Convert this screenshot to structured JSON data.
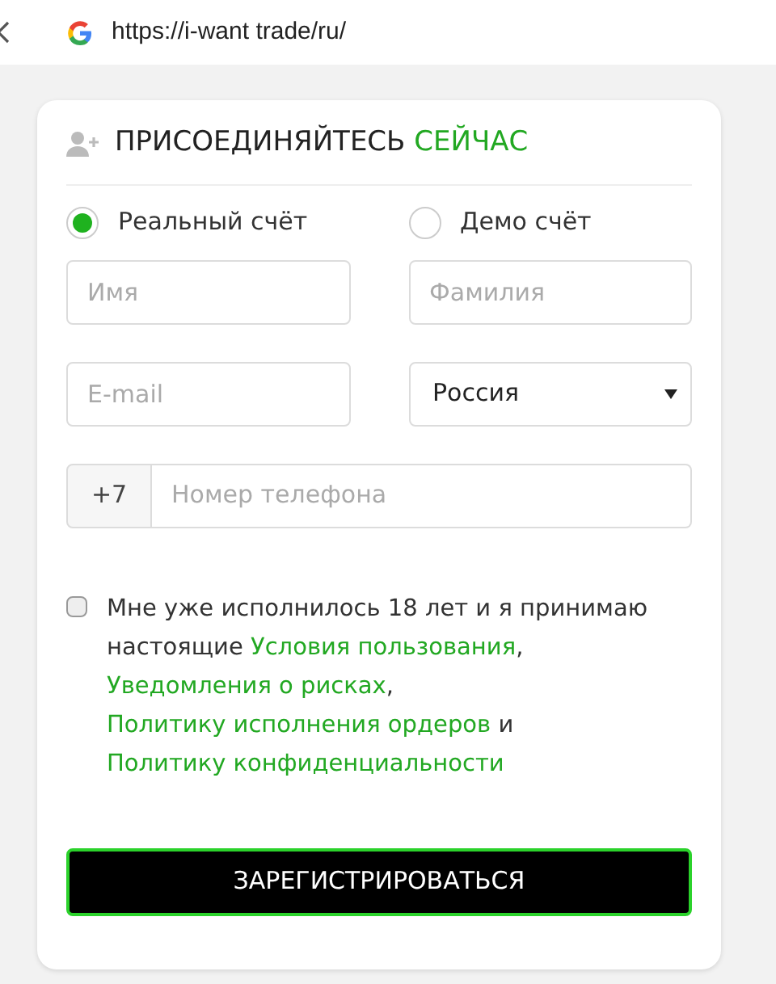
{
  "browser": {
    "url": "https://i-want trade/ru/"
  },
  "form": {
    "title": "ПРИСОЕДИНЯЙТЕСЬ",
    "title_accent": "СЕЙЧАС",
    "account_types": [
      {
        "label": "Реальный счёт",
        "selected": true
      },
      {
        "label": "Демо счёт",
        "selected": false
      }
    ],
    "first_name": {
      "placeholder": "Имя"
    },
    "last_name": {
      "placeholder": "Фамилия"
    },
    "email": {
      "placeholder": "E-mail"
    },
    "country": {
      "value": "Россия"
    },
    "phone": {
      "prefix": "+7",
      "placeholder": "Номер телефона"
    },
    "agreement": {
      "checked": false,
      "parts": [
        {
          "kind": "text",
          "text": "Мне уже исполнилось 18 лет и я принимаю настоящие "
        },
        {
          "kind": "link",
          "text": "Условия пользования"
        },
        {
          "kind": "text",
          "text": ", "
        },
        {
          "kind": "link",
          "text": "Уведомления о рисках"
        },
        {
          "kind": "text",
          "text": ", "
        },
        {
          "kind": "link",
          "text": "Политику исполнения ордеров"
        },
        {
          "kind": "text",
          "text": " и "
        },
        {
          "kind": "link",
          "text": "Политику конфиденциальности"
        }
      ]
    },
    "submit": "ЗАРЕГИСТРИРОВАТЬСЯ"
  }
}
